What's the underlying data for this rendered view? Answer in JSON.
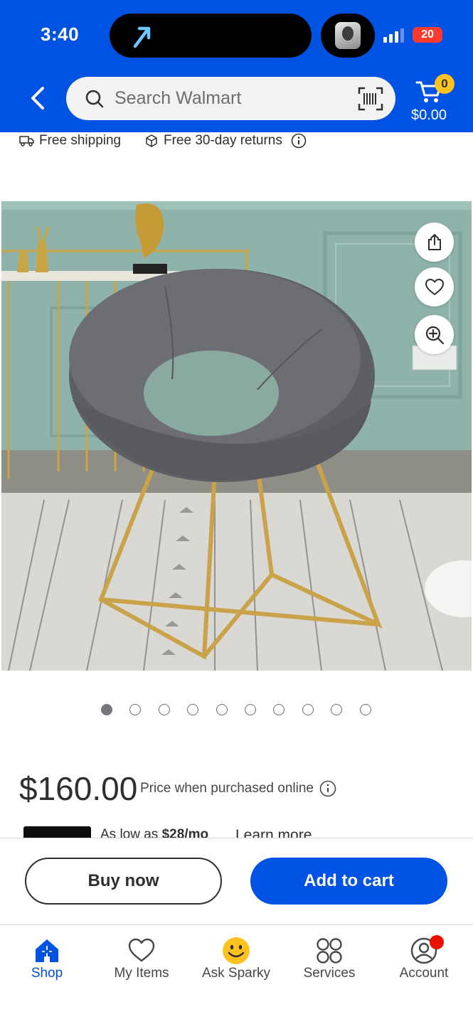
{
  "status_bar": {
    "time": "3:40",
    "battery": "20"
  },
  "header": {
    "search": {
      "placeholder": "Search Walmart",
      "value": ""
    },
    "cart": {
      "count": "0",
      "total": "$0.00"
    }
  },
  "shipping": {
    "free_shipping": "Free shipping",
    "returns": "Free 30-day returns"
  },
  "product": {
    "image_alt": "Gray velvet round accent chair with gold metal legs",
    "image_count": 10,
    "active_image_index": 0,
    "price": "$160.00",
    "price_note": "Price when purchased online",
    "financing": {
      "prefix": "As low as ",
      "amount": "$28/mo",
      "learn_more": "Learn more"
    }
  },
  "actions": {
    "buy_now": "Buy now",
    "add_to_cart": "Add to cart"
  },
  "bottom_nav": {
    "items": [
      {
        "label": "Shop",
        "icon": "shop-icon",
        "active": true
      },
      {
        "label": "My Items",
        "icon": "heart-icon",
        "active": false
      },
      {
        "label": "Ask Sparky",
        "icon": "sparky-icon",
        "active": false
      },
      {
        "label": "Services",
        "icon": "services-icon",
        "active": false
      },
      {
        "label": "Account",
        "icon": "account-icon",
        "active": false,
        "notification": true
      }
    ]
  },
  "colors": {
    "brand_blue": "#0053e2",
    "spark_yellow": "#ffc220",
    "notification_red": "#ea1100"
  }
}
